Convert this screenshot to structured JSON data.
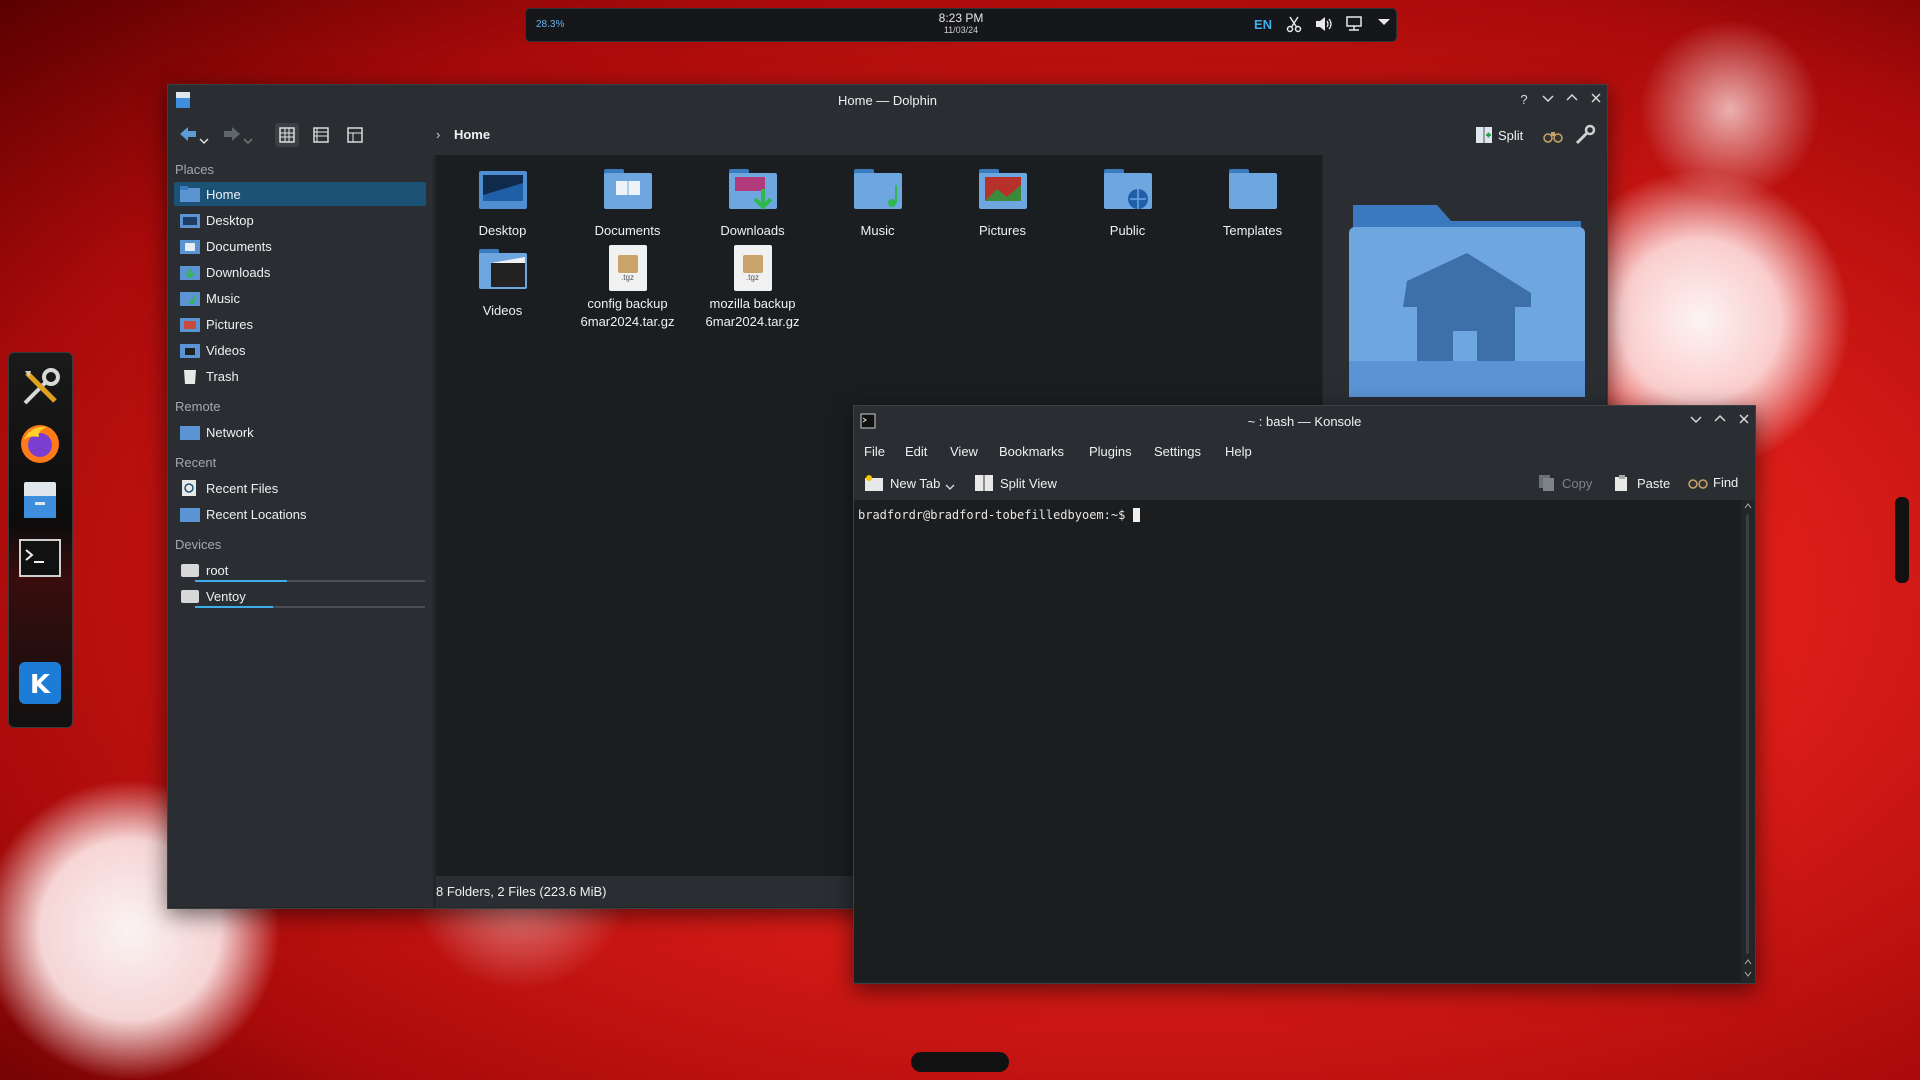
{
  "top_panel": {
    "cpu_label": "28.3%",
    "time": "8:23 PM",
    "date": "11/03/24",
    "keyboard_layout": "EN"
  },
  "dock": {
    "items": [
      "system-settings-icon",
      "firefox-icon",
      "file-manager-icon",
      "konsole-icon",
      "kde-application-launcher-icon"
    ]
  },
  "dolphin": {
    "title": "Home — Dolphin",
    "breadcrumb": "Home",
    "split_label": "Split",
    "places_header": "Places",
    "places": [
      "Home",
      "Desktop",
      "Documents",
      "Downloads",
      "Music",
      "Pictures",
      "Videos",
      "Trash"
    ],
    "remote_header": "Remote",
    "remote": [
      "Network"
    ],
    "recent_header": "Recent",
    "recent": [
      "Recent Files",
      "Recent Locations"
    ],
    "devices_header": "Devices",
    "devices": [
      {
        "name": "root",
        "usage": 0.4
      },
      {
        "name": "Ventoy",
        "usage": 0.34
      }
    ],
    "files": [
      {
        "name": "Desktop",
        "type": "folder"
      },
      {
        "name": "Documents",
        "type": "folder"
      },
      {
        "name": "Downloads",
        "type": "folder"
      },
      {
        "name": "Music",
        "type": "folder"
      },
      {
        "name": "Pictures",
        "type": "folder"
      },
      {
        "name": "Public",
        "type": "folder"
      },
      {
        "name": "Templates",
        "type": "folder"
      },
      {
        "name": "Videos",
        "type": "folder"
      },
      {
        "name": "config backup 6mar2024.tar.gz",
        "line1": "config backup",
        "line2": "6mar2024.tar.gz",
        "type": "tgz"
      },
      {
        "name": "mozilla backup 6mar2024.tar.gz",
        "line1": "mozilla backup",
        "line2": "6mar2024.tar.gz",
        "type": "tgz"
      }
    ],
    "tgz_label": ".tgz",
    "status": "8 Folders, 2 Files (223.6 MiB)"
  },
  "konsole": {
    "title": "~ : bash — Konsole",
    "menu": [
      "File",
      "Edit",
      "View",
      "Bookmarks",
      "Plugins",
      "Settings",
      "Help"
    ],
    "toolbar": {
      "new_tab": "New Tab",
      "split_view": "Split View",
      "copy": "Copy",
      "paste": "Paste",
      "find": "Find"
    },
    "prompt": "bradfordr@bradford-tobefilledbyoem:~$"
  },
  "colors": {
    "accent": "#3daee9",
    "selection": "#1d5277",
    "window_bg": "#232629",
    "view_bg": "#1b1e20"
  }
}
